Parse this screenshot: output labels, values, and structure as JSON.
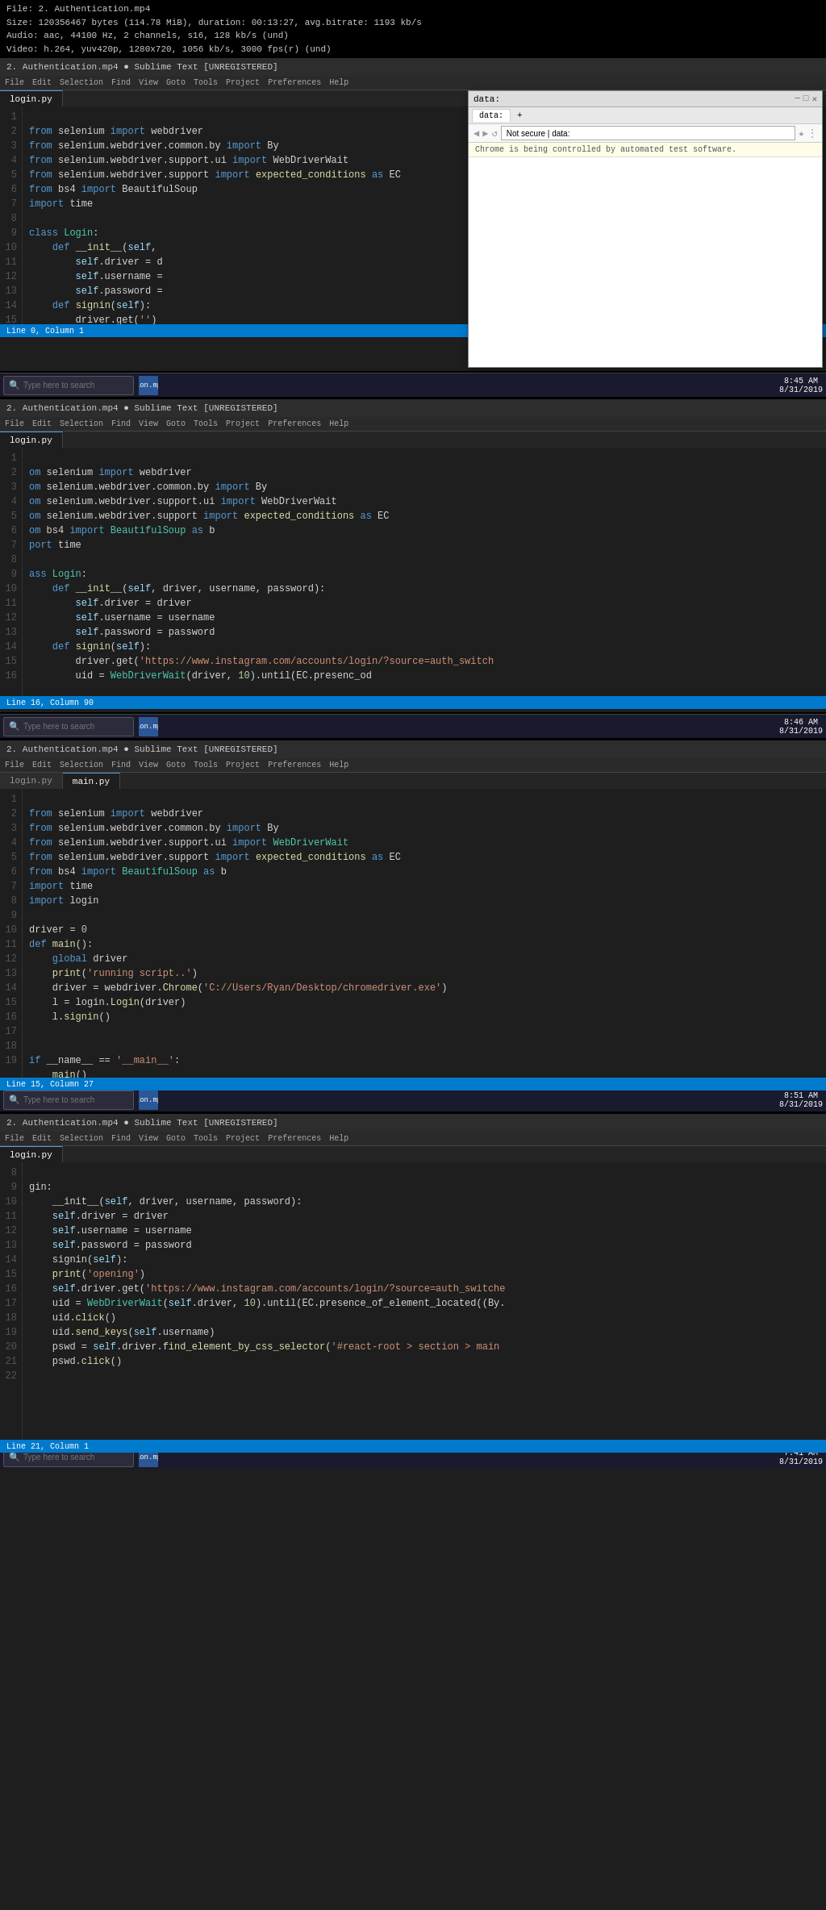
{
  "videoInfo": {
    "line1": "File: 2. Authentication.mp4",
    "line2": "Size: 120356467 bytes (114.78 MiB), duration: 00:13:27, avg.bitrate: 1193 kb/s",
    "line3": "Audio: aac, 44100 Hz, 2 channels, s16, 128 kb/s (und)",
    "line4": "Video: h.264, yuv420p, 1280x720, 1056 kb/s, 3000 fps(r) (und)"
  },
  "editor1": {
    "title": "2. Authentication.mp4 ● Sublime Text [UNREGISTERED]",
    "menuItems": [
      "File",
      "Edit",
      "Selection",
      "Find",
      "View",
      "Goto",
      "Tools",
      "Project",
      "Preferences",
      "Help"
    ],
    "tab": "login.py",
    "statusLeft": "Line 0, Column 1",
    "lines": [
      {
        "num": "1",
        "code": "from selenium import webdriver"
      },
      {
        "num": "2",
        "code": "from selenium.webdriver.common.by import By"
      },
      {
        "num": "3",
        "code": "from selenium.webdriver.support.ui import WebDriverWait"
      },
      {
        "num": "4",
        "code": "from selenium.webdriver.support import expected_conditions as EC"
      },
      {
        "num": "5",
        "code": "from bs4 import BeautifulSoup"
      },
      {
        "num": "6",
        "code": "import time"
      },
      {
        "num": "7",
        "code": ""
      },
      {
        "num": "8",
        "code": "class Login:"
      },
      {
        "num": "9",
        "code": "    def __init__(self,"
      },
      {
        "num": "10",
        "code": "        self.driver = d"
      },
      {
        "num": "11",
        "code": "        self.username ="
      },
      {
        "num": "12",
        "code": "        self.password ="
      },
      {
        "num": "13",
        "code": "    def signin(self):"
      },
      {
        "num": "14",
        "code": "        driver.get('')"
      },
      {
        "num": "15",
        "code": ""
      }
    ]
  },
  "browser": {
    "tab": "data:",
    "url": "Not secure | data:",
    "controlledMsg": "Chrome is being controlled by automated test software.",
    "contentText": ""
  },
  "editor2": {
    "title": "2. Authentication.mp4 ● Sublime Text [UNREGISTERED]",
    "menuItems": [
      "File",
      "Edit",
      "Selection",
      "Find",
      "View",
      "Goto",
      "Tools",
      "Project",
      "Preferences",
      "Help"
    ],
    "tab": "login.py",
    "time": "8:46 AM",
    "date": "8/31/2019",
    "statusLeft": "Line 16, Column 90",
    "lines": [
      {
        "num": "1",
        "code": "om selenium import webdriver"
      },
      {
        "num": "2",
        "code": "om selenium.webdriver.common.by import By"
      },
      {
        "num": "3",
        "code": "om selenium.webdriver.support.ui import WebDriverWait"
      },
      {
        "num": "4",
        "code": "om selenium.webdriver.support import expected_conditions as EC"
      },
      {
        "num": "5",
        "code": "om bs4 import BeautifulSoup as b"
      },
      {
        "num": "6",
        "code": "port time"
      },
      {
        "num": "7",
        "code": ""
      },
      {
        "num": "8",
        "code": "ass Login:"
      },
      {
        "num": "9",
        "code": "    def __init__(self, driver, username, password):"
      },
      {
        "num": "10",
        "code": "        self.driver = driver"
      },
      {
        "num": "11",
        "code": "        self.username = username"
      },
      {
        "num": "12",
        "code": "        self.password = password"
      },
      {
        "num": "13",
        "code": "    def signin(self):"
      },
      {
        "num": "14",
        "code": "        driver.get('https://www.instagram.com/accounts/login/?source=auth_switch"
      },
      {
        "num": "15",
        "code": "        uid = WebDriverWait(driver, 10).until(EC.presenc_od"
      },
      {
        "num": "16",
        "code": ""
      }
    ]
  },
  "editor3": {
    "title": "2. Authentication.mp4 ● Sublime Text [UNREGISTERED]",
    "tab": "main.py",
    "time": "8:51 AM",
    "date": "8/31/2019",
    "statusLeft": "Line 15, Column 27",
    "lines": [
      {
        "num": "1",
        "code": "from selenium import webdriver"
      },
      {
        "num": "2",
        "code": "from selenium.webdriver.common.by import By"
      },
      {
        "num": "3",
        "code": "from selenium.webdriver.support.ui import WebDriverWait"
      },
      {
        "num": "4",
        "code": "from selenium.webdriver.support import expected_conditions as EC"
      },
      {
        "num": "5",
        "code": "from bs4 import BeautifulSoup as b"
      },
      {
        "num": "6",
        "code": "import time"
      },
      {
        "num": "7",
        "code": "import login"
      },
      {
        "num": "8",
        "code": ""
      },
      {
        "num": "9",
        "code": "driver = 0"
      },
      {
        "num": "10",
        "code": "def main():"
      },
      {
        "num": "11",
        "code": "    global driver"
      },
      {
        "num": "12",
        "code": "    print('running script..')"
      },
      {
        "num": "13",
        "code": "    driver = webdriver.Chrome('C://Users/Ryan/Desktop/chromedriver.exe')"
      },
      {
        "num": "14",
        "code": "    l = login.Login(driver)"
      },
      {
        "num": "15",
        "code": "    l.signin()"
      },
      {
        "num": "16",
        "code": ""
      },
      {
        "num": "17",
        "code": ""
      },
      {
        "num": "18",
        "code": "if __name__ == '__main__':"
      },
      {
        "num": "19",
        "code": "    main()"
      }
    ]
  },
  "editor4": {
    "title": "2. Authentication.mp4 ● Sublime Text [UNREGISTERED]",
    "tab": "login.py",
    "time": "7:41 AM",
    "date": "8/31/2019",
    "statusLeft": "Line 21, Column 1",
    "lines": [
      {
        "num": "8",
        "code": "gin:"
      },
      {
        "num": "9",
        "code": "    __init__(self, driver, username, password):"
      },
      {
        "num": "10",
        "code": "    self.driver = driver"
      },
      {
        "num": "11",
        "code": "    self.username = username"
      },
      {
        "num": "12",
        "code": "    self.password = password"
      },
      {
        "num": "13",
        "code": "    signin(self):"
      },
      {
        "num": "14",
        "code": "    print('opening')"
      },
      {
        "num": "15",
        "code": "    self.driver.get('https://www.instagram.com/accounts/login/?source=auth_switche"
      },
      {
        "num": "16",
        "code": "    uid = WebDriverWait(self.driver, 10).until(EC.presence_of_element_located((By."
      },
      {
        "num": "17",
        "code": "    uid.click()"
      },
      {
        "num": "18",
        "code": "    uid.send_keys(self.username)"
      },
      {
        "num": "19",
        "code": "    pswd = self.driver.find_element_by_css_selector('#react-root > section > main"
      },
      {
        "num": "20",
        "code": "    pswd.click()"
      },
      {
        "num": "21",
        "code": ""
      },
      {
        "num": "22",
        "code": ""
      }
    ]
  },
  "taskbars": [
    {
      "time": "8:45 AM",
      "date": "8/31/2019"
    },
    {
      "time": "8:46 AM",
      "date": "8/31/2019"
    },
    {
      "time": "8:51 AM",
      "date": "8/31/2019"
    },
    {
      "time": "7:41 AM",
      "date": "8/31/2019"
    }
  ]
}
